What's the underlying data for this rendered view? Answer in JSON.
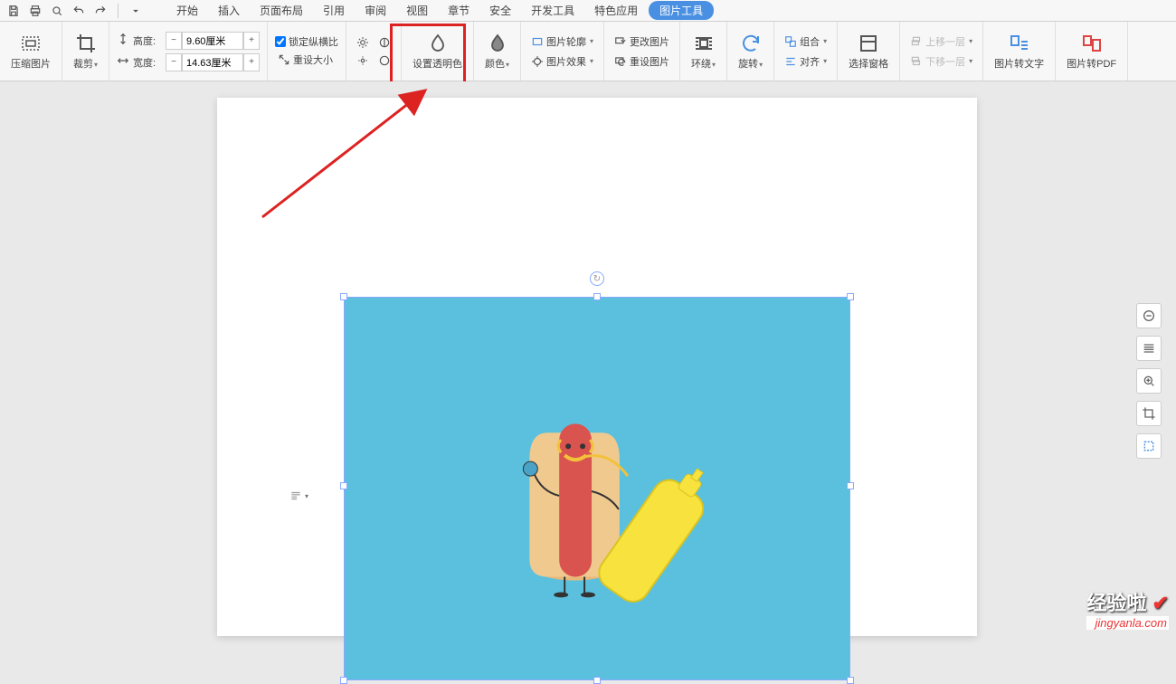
{
  "menu": {
    "start": "开始",
    "insert": "插入",
    "pagelayout": "页面布局",
    "ref": "引用",
    "review": "审阅",
    "view": "视图",
    "section": "章节",
    "security": "安全",
    "devtools": "开发工具",
    "special": "特色应用",
    "picturetools": "图片工具"
  },
  "toolbar": {
    "compress": "压缩图片",
    "crop": "裁剪",
    "height_label": "高度:",
    "height_value": "9.60厘米",
    "width_label": "宽度:",
    "width_value": "14.63厘米",
    "lockratio": "锁定纵横比",
    "resetsize": "重设大小",
    "settransparent": "设置透明色",
    "color": "颜色",
    "outline": "图片轮廓",
    "effect": "图片效果",
    "changepic": "更改图片",
    "resetpic": "重设图片",
    "wrap": "环绕",
    "rotate": "旋转",
    "group": "组合",
    "align": "对齐",
    "selpane": "选择窗格",
    "moveup": "上移一层",
    "movedown": "下移一层",
    "totext": "图片转文字",
    "topdf": "图片转PDF"
  },
  "watermark": {
    "line1": "经验啦",
    "line2": "jingyanla.com"
  }
}
